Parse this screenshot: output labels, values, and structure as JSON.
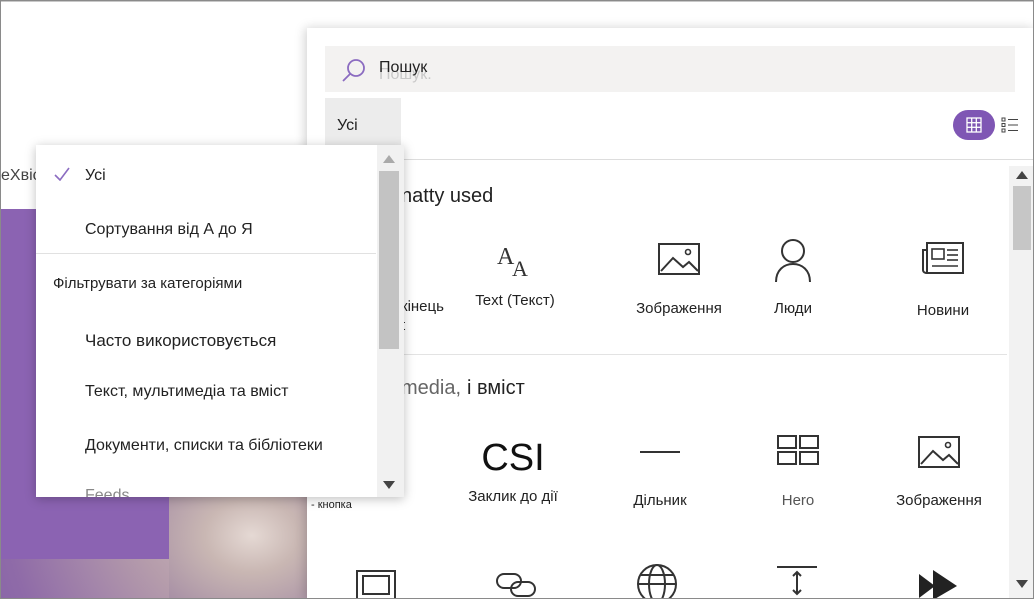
{
  "background": {
    "left_text": "еХвіст",
    "button_label": "- кнопка"
  },
  "panel": {
    "search": {
      "value": "Пошук",
      "ghost": "Пошук."
    },
    "tab_all": "Усі",
    "section1_title": "natty used",
    "section2_title_a": "media,",
    "section2_title_b": "і вміст",
    "row1": [
      {
        "label": "кінець",
        "sublabel": "t"
      },
      {
        "label": "Text (Текст)",
        "icon": "text-icon"
      },
      {
        "label": "Зображення",
        "icon": "image-icon"
      },
      {
        "label": "Люди",
        "icon": "person-icon"
      },
      {
        "label": "Новини",
        "icon": "news-icon"
      }
    ],
    "row2": [
      {
        "label": "Заклик до дії",
        "icon_text": "CSI",
        "icon": "call-to-action-icon"
      },
      {
        "label": "Дільник",
        "icon": "divider-icon"
      },
      {
        "label": "Hero",
        "icon": "hero-icon"
      },
      {
        "label": "Зображення",
        "icon": "image-icon"
      }
    ],
    "row3_icons": [
      "gallery-icon",
      "link-icon",
      "globe-icon",
      "spacer-icon",
      "stream-icon"
    ]
  },
  "dropdown": {
    "items": [
      "Усі",
      "Сортування від А до Я",
      "Фільтрувати за категоріями",
      "Часто використовується",
      "Текст, мультимедіа та вміст",
      "Документи, списки та бібліотеки",
      "Feeds"
    ]
  },
  "colors": {
    "accent": "#7f56b4",
    "check": "#8b6cc1"
  }
}
